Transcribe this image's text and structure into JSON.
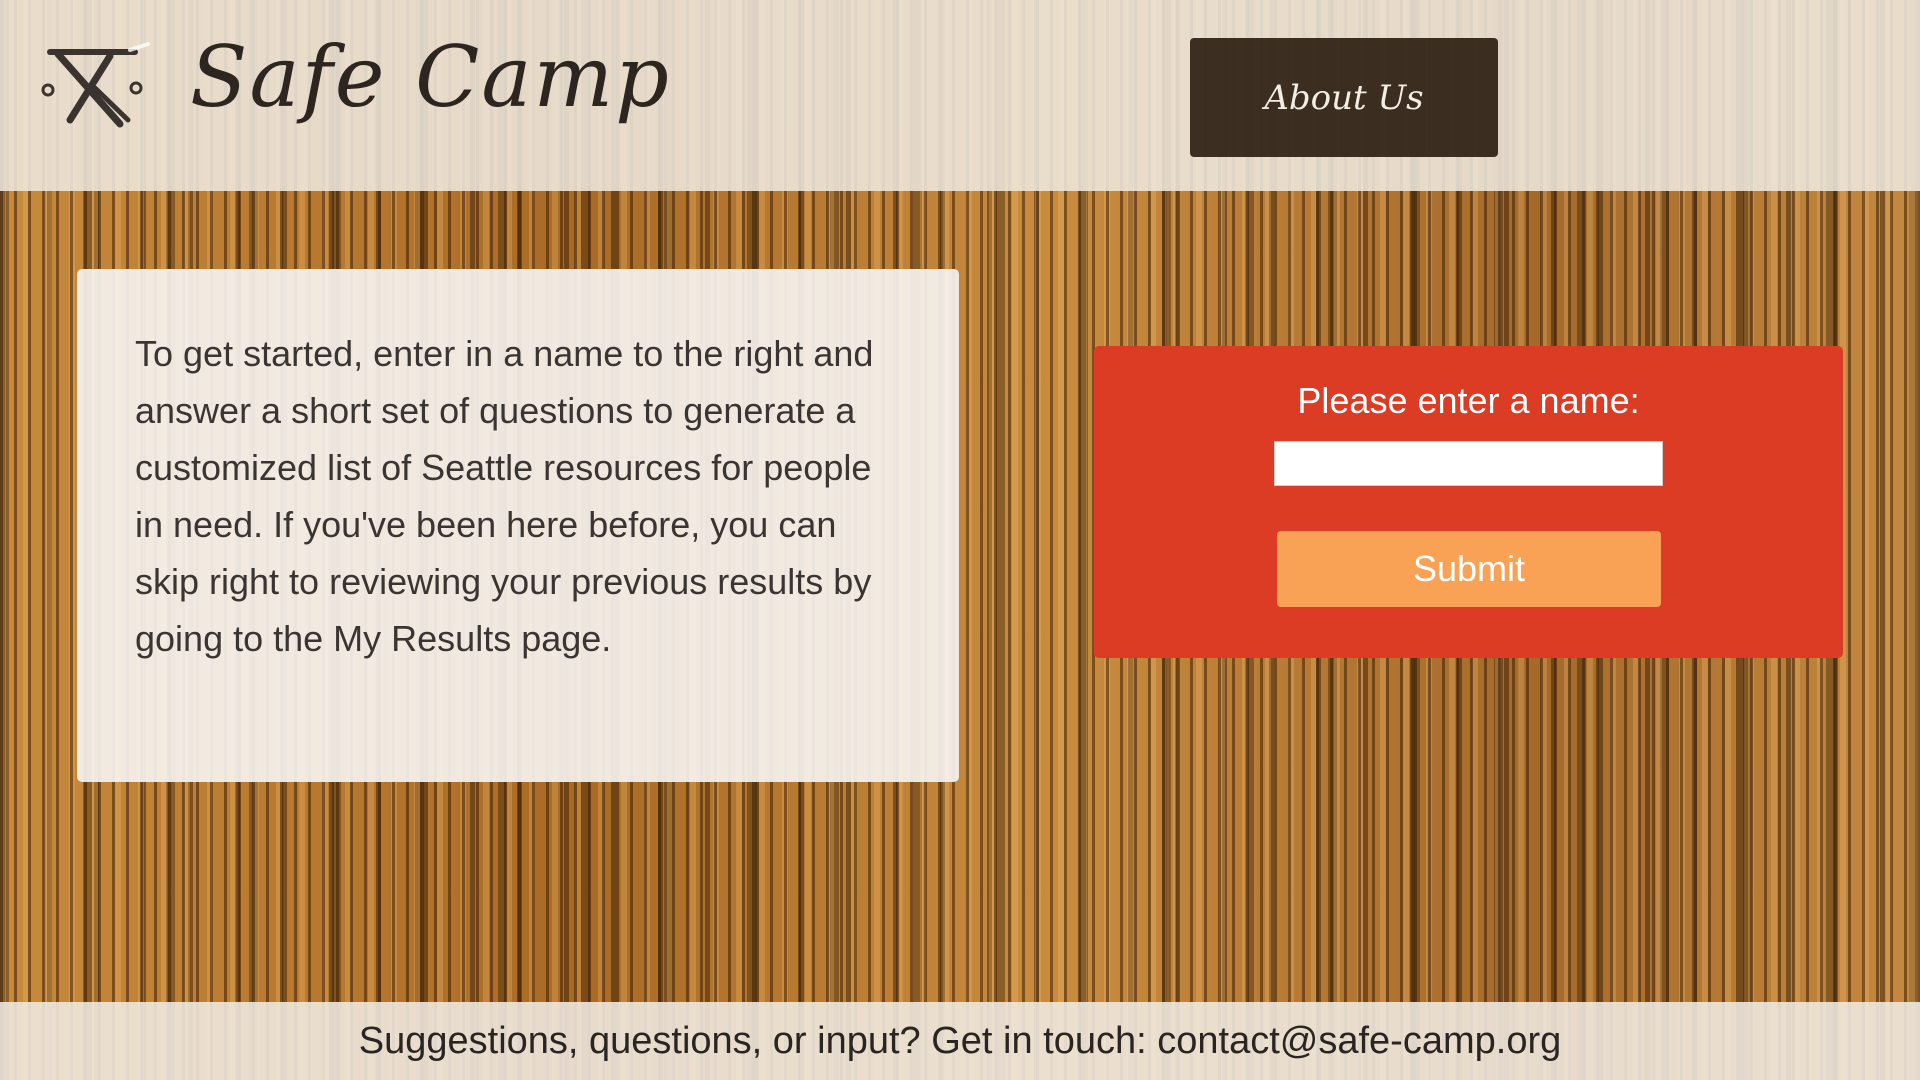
{
  "header": {
    "site_title": "Safe Camp",
    "logo_icon": "crossed-sticks-logo-icon",
    "about_button_label": "About Us"
  },
  "info_panel": {
    "text": "To get started, enter in a name to the right and answer a short set of questions to generate a customized list of Seattle resources for people in need. If you've been here before, you can skip right to reviewing your previous results by going to the My Results page."
  },
  "name_form": {
    "label": "Please enter a name:",
    "input_value": "",
    "submit_label": "Submit"
  },
  "footer": {
    "prompt": "Suggestions, questions, or input? Get in touch: ",
    "email": "contact@safe-camp.org"
  },
  "colors": {
    "form_background": "#dc3c24",
    "submit_button": "#f9a255",
    "about_button": "#2d2012"
  }
}
